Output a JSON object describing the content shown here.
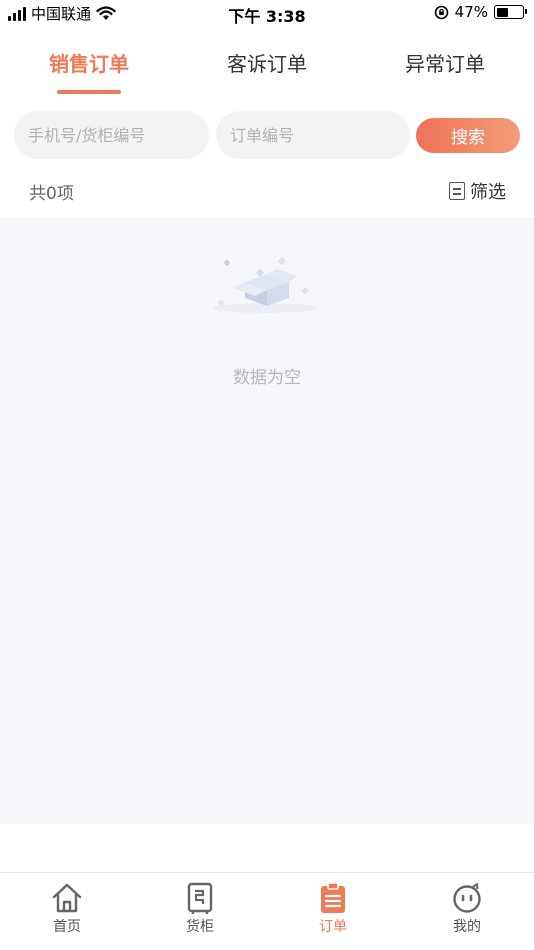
{
  "status_bar": {
    "carrier": "中国联通",
    "time": "下午 3:38",
    "battery": "47%",
    "battery_level": 0.47
  },
  "tabs": [
    {
      "label": "销售订单",
      "active": true
    },
    {
      "label": "客诉订单",
      "active": false
    },
    {
      "label": "异常订单",
      "active": false
    }
  ],
  "search": {
    "phone_placeholder": "手机号/货柜编号",
    "order_placeholder": "订单编号",
    "button_label": "搜索"
  },
  "summary": {
    "count_text": "共0项",
    "filter_label": "筛选"
  },
  "empty_state": {
    "text": "数据为空"
  },
  "bottom_nav": [
    {
      "label": "首页",
      "icon": "home-icon",
      "active": false
    },
    {
      "label": "货柜",
      "icon": "cabinet-icon",
      "active": false
    },
    {
      "label": "订单",
      "icon": "order-clipboard-icon",
      "active": true
    },
    {
      "label": "我的",
      "icon": "profile-face-icon",
      "active": false
    }
  ],
  "colors": {
    "accent": "#ef7b56",
    "background": "#f6f7fb",
    "input_bg": "#f3f3f5"
  }
}
